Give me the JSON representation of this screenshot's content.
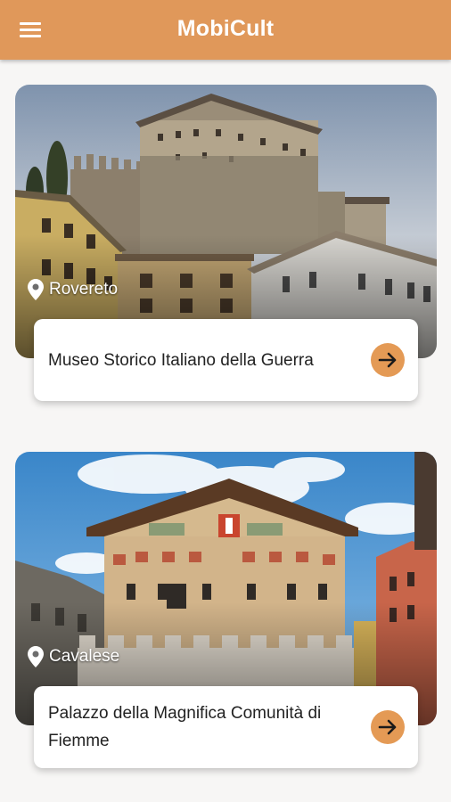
{
  "app": {
    "title": "MobiCult",
    "menu_icon": "menu-icon",
    "accent_color": "#e0985a"
  },
  "places": [
    {
      "location": "Rovereto",
      "name": "Museo Storico Italiano della Guerra",
      "image": "castle-photo",
      "action_icon": "arrow-right-icon"
    },
    {
      "location": "Cavalese",
      "name": "Palazzo della Magnifica Comunità di Fiemme",
      "image": "palazzo-photo",
      "action_icon": "arrow-right-icon"
    }
  ]
}
